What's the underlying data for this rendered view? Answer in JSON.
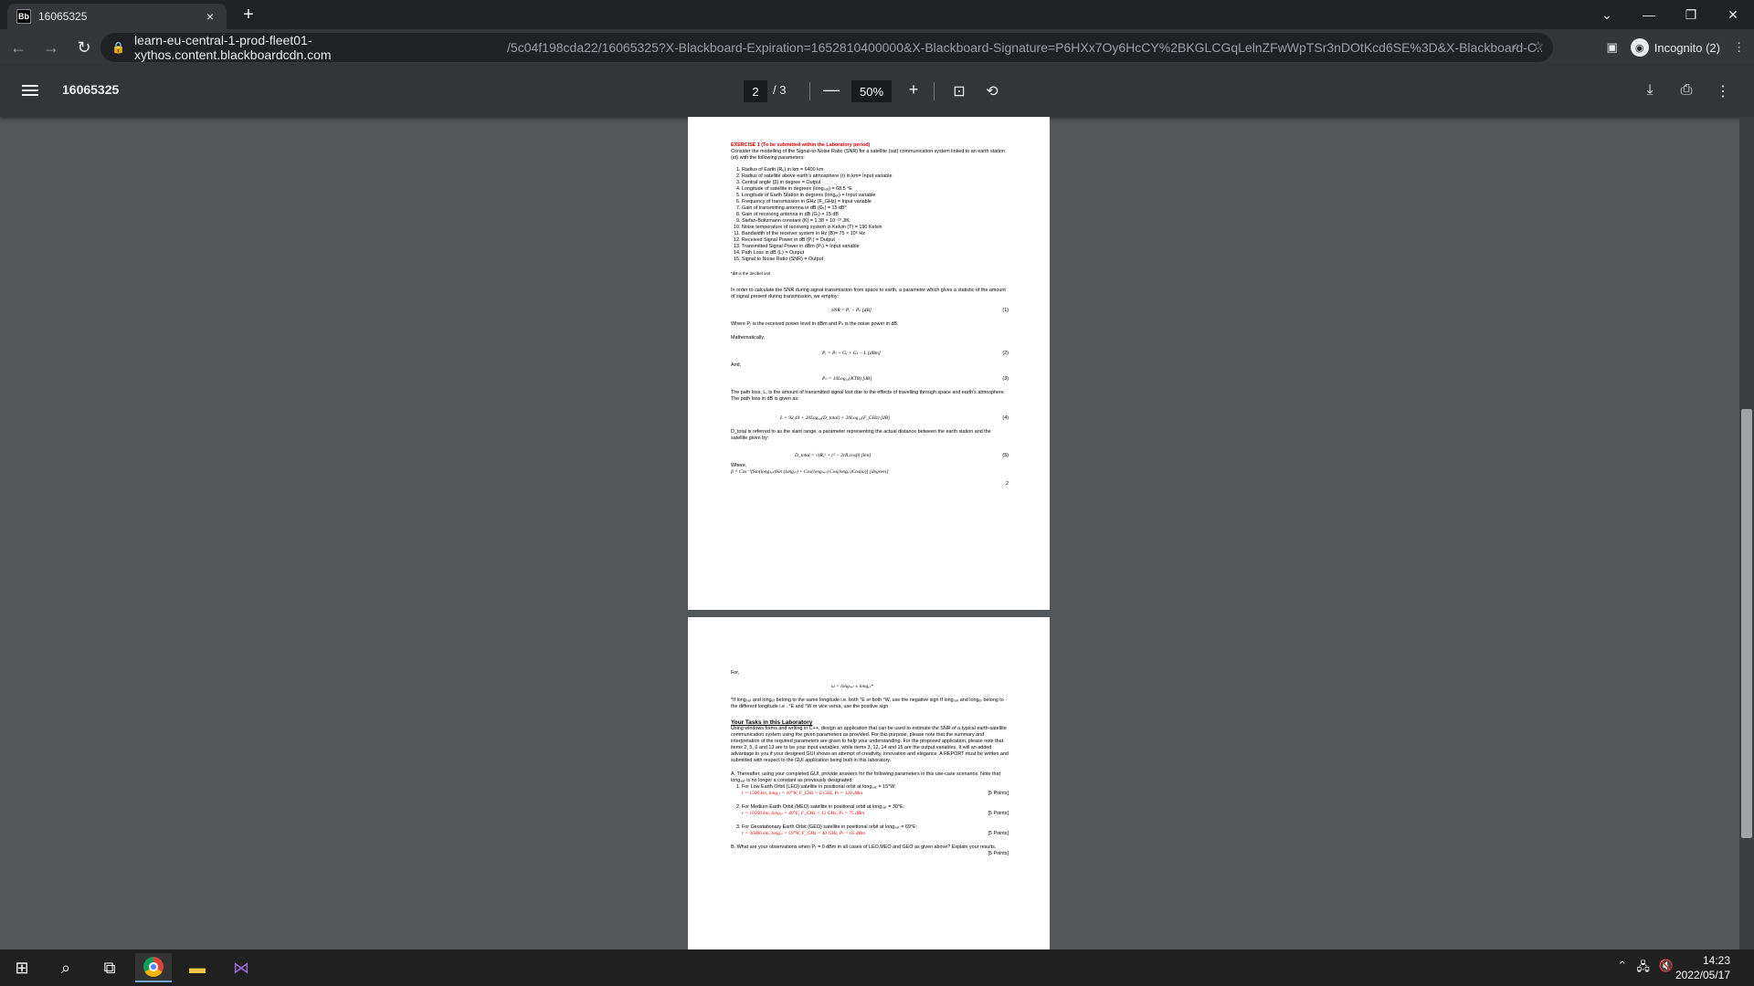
{
  "browser": {
    "tab": {
      "favicon": "Bb",
      "title": "16065325",
      "close": "×"
    },
    "new_tab": "+",
    "url_host": "learn-eu-central-1-prod-fleet01-xythos.content.blackboardcdn.com",
    "url_rest": "/5c04f198cda22/16065325?X-Blackboard-Expiration=1652810400000&X-Blackboard-Signature=P6HXx7Oy6HcCY%2BKGLCGqLelnZFwWpTSr3nDOtKcd6SE%3D&X-Blackboard-C...",
    "profile_label": "Incognito (2)"
  },
  "pdf_toolbar": {
    "title": "16065325",
    "page_current": "2",
    "page_total": "/ 3",
    "zoom": "50%"
  },
  "page2": {
    "ex_heading": "EXERCISE 1 (To be submitted within the Laboratory period)",
    "intro": "Consider the modelling of the Signal-to-Noise Ratio (SNR) for a satellite (sat) communication system linked to an earth station (et) with the following parameters:",
    "params": [
      "Radius of Earth (Rₑ) in km = 6400 km",
      "Radius of satellite above earth's atmosphere (r) in km= Input variable",
      "Central angle (β) in degree = Output",
      "Longitude of satellite in degrees (longₛₐₜ) = 68.5 °E",
      "Longitude of Earth Station in degrees (longₑₜ) = Input variable",
      "Frequency of transmission in GHz (F_GHz) = Input variable",
      "Gain of transmitting antenna in dB (Gₜ) = 15 dB*",
      "Gain of receiving antenna in dB (Gᵣ) = 15 dB",
      "Stefan-Boltzmann constant (K) = 1.38 × 10⁻²³ J/K",
      "Noise temperature of receiving system in Kelvin (T) = 190 Kelvin",
      "Bandwidth of the receiver system in Hz (B)= 75 × 10⁶ Hz",
      "Received Signal Power in dB (Pᵣ) = Output",
      "Transmitted Signal Power in dBm (Pₜ) = Input variable",
      "Path Loss in dB (L) = Output",
      "Signal to Noise Ratio (SNR) = Output"
    ],
    "footnote": "*dB is the decibel unit",
    "para1": "In order to calculate the SNR during signal transmission from space to earth, a parameter which gives a statistic of the amount of signal present during transmission, we employ:",
    "eq1": "SNR = Pᵣ − Pₙ      [dB]",
    "eq1_num": "(1)",
    "where1": "Where Pᵣ is the received power level in dBm and Pₙ is the noise power in dB.",
    "math": "Mathematically,",
    "eq2": "Pᵣ = Pₜ + Gᵣ + Gₜ − L      [dBm]",
    "eq2_num": "(2)",
    "and": "And,",
    "eq3": "Pₙ = 10Log₁₀(KTB)          [dB]",
    "eq3_num": "(3)",
    "para2": "The path loss, L, is the amount of transmitted signal lost due to the effects of travelling through space and earth's atmosphere. The path loss in dB is given as:",
    "eq4": "L = 92.44 + 20Log₁₀(D_total) + 20Log₁₀(F_GHz)        [dB]",
    "eq4_num": "(4)",
    "para3": "D_total is referred to as the slant range, a parameter representing the actual distance between the earth station and the satellite given by:",
    "eq5": "D_total = √(Rₑ² + r² − 2rRₑcosβ)          [km]",
    "eq5_num": "(5)",
    "where2": "Where,",
    "eq6": "β = Cos⁻¹[Sin(longₛₐₜ)Sin (longₑₜ) + Cos(longₛₐₜ) Cos(longₑₜ)Cos(ω)]  [degrees]",
    "page_num": "2"
  },
  "page3": {
    "for": "For,",
    "omega": "ω = longₛₐₜ ± longₑₜ*",
    "note": "*If longₛₐₜ and longₑₜ belong to the same longitude i.e. both °E or both °W, use the negative sign If longₛₐₜ and longₑₜ belong to the different longitude i.e . °E and °W or vice versa, use the positive sign",
    "tasks_heading": "Your Tasks in this Laboratory",
    "tasks_text": "Using windows forms and writing in C++, design an application that can be used to estimate the SNR of a typical earth-satellite communication system using the given parameters as provided. For this purpose, please note that the summary and interpretation of the required parameters are given to help your understanding. For the proposed application, please note that items 2, 5, 6 and 13 are to be your input variables, while items 3, 12, 14 and 15 are the output variables. It will an added advantage to you if your designed GUI shows an attempt of creativity, innovation and elegance. A REPORT must be written and submitted with respect to the GUI application being built in this laboratory.",
    "partA": "A. Thereafter, using your completed GUI, provide answers for the following parameters in this use-case scenarios. Note that longₛₐₜ is no longer a constant as previously designated:",
    "cases": [
      {
        "label": "For Low Earth Orbit (LEO) satellite in positional orbit at longₛₐₜ = 15°W:",
        "values": "r = 1500 km, longₑₜ = 10°W, F_GHz = 6 GHz, Pₜ = 120 dBm",
        "points": "[5 Points]"
      },
      {
        "label": "For Medium Earth Orbit (MEO) satellite in positional orbit at longₛₐₜ = 30°E:",
        "values": "r = 10500 km, longₑₜ = 40°E, F_GHz = 12 GHz, Pₜ = 75 dBm",
        "points": "[5 Points]"
      },
      {
        "label": "For Geostationary Earth Orbit (GEO) satellite in positional orbit at longₛₐₜ = 69°E:",
        "values": "r = 36000 km, longₑₜ = 59°W, F_GHz = 40 GHz, Pₜ = 65 dBm",
        "points": "[5 Points]"
      }
    ],
    "partB": "B. What are your observations when Pₜ = 0 dBm in all cases of LEO,MEO and GEO as given above? Explain your results.",
    "partB_points": "[5 Points]"
  },
  "taskbar": {
    "time": "14:23",
    "date": "2022/05/17"
  }
}
